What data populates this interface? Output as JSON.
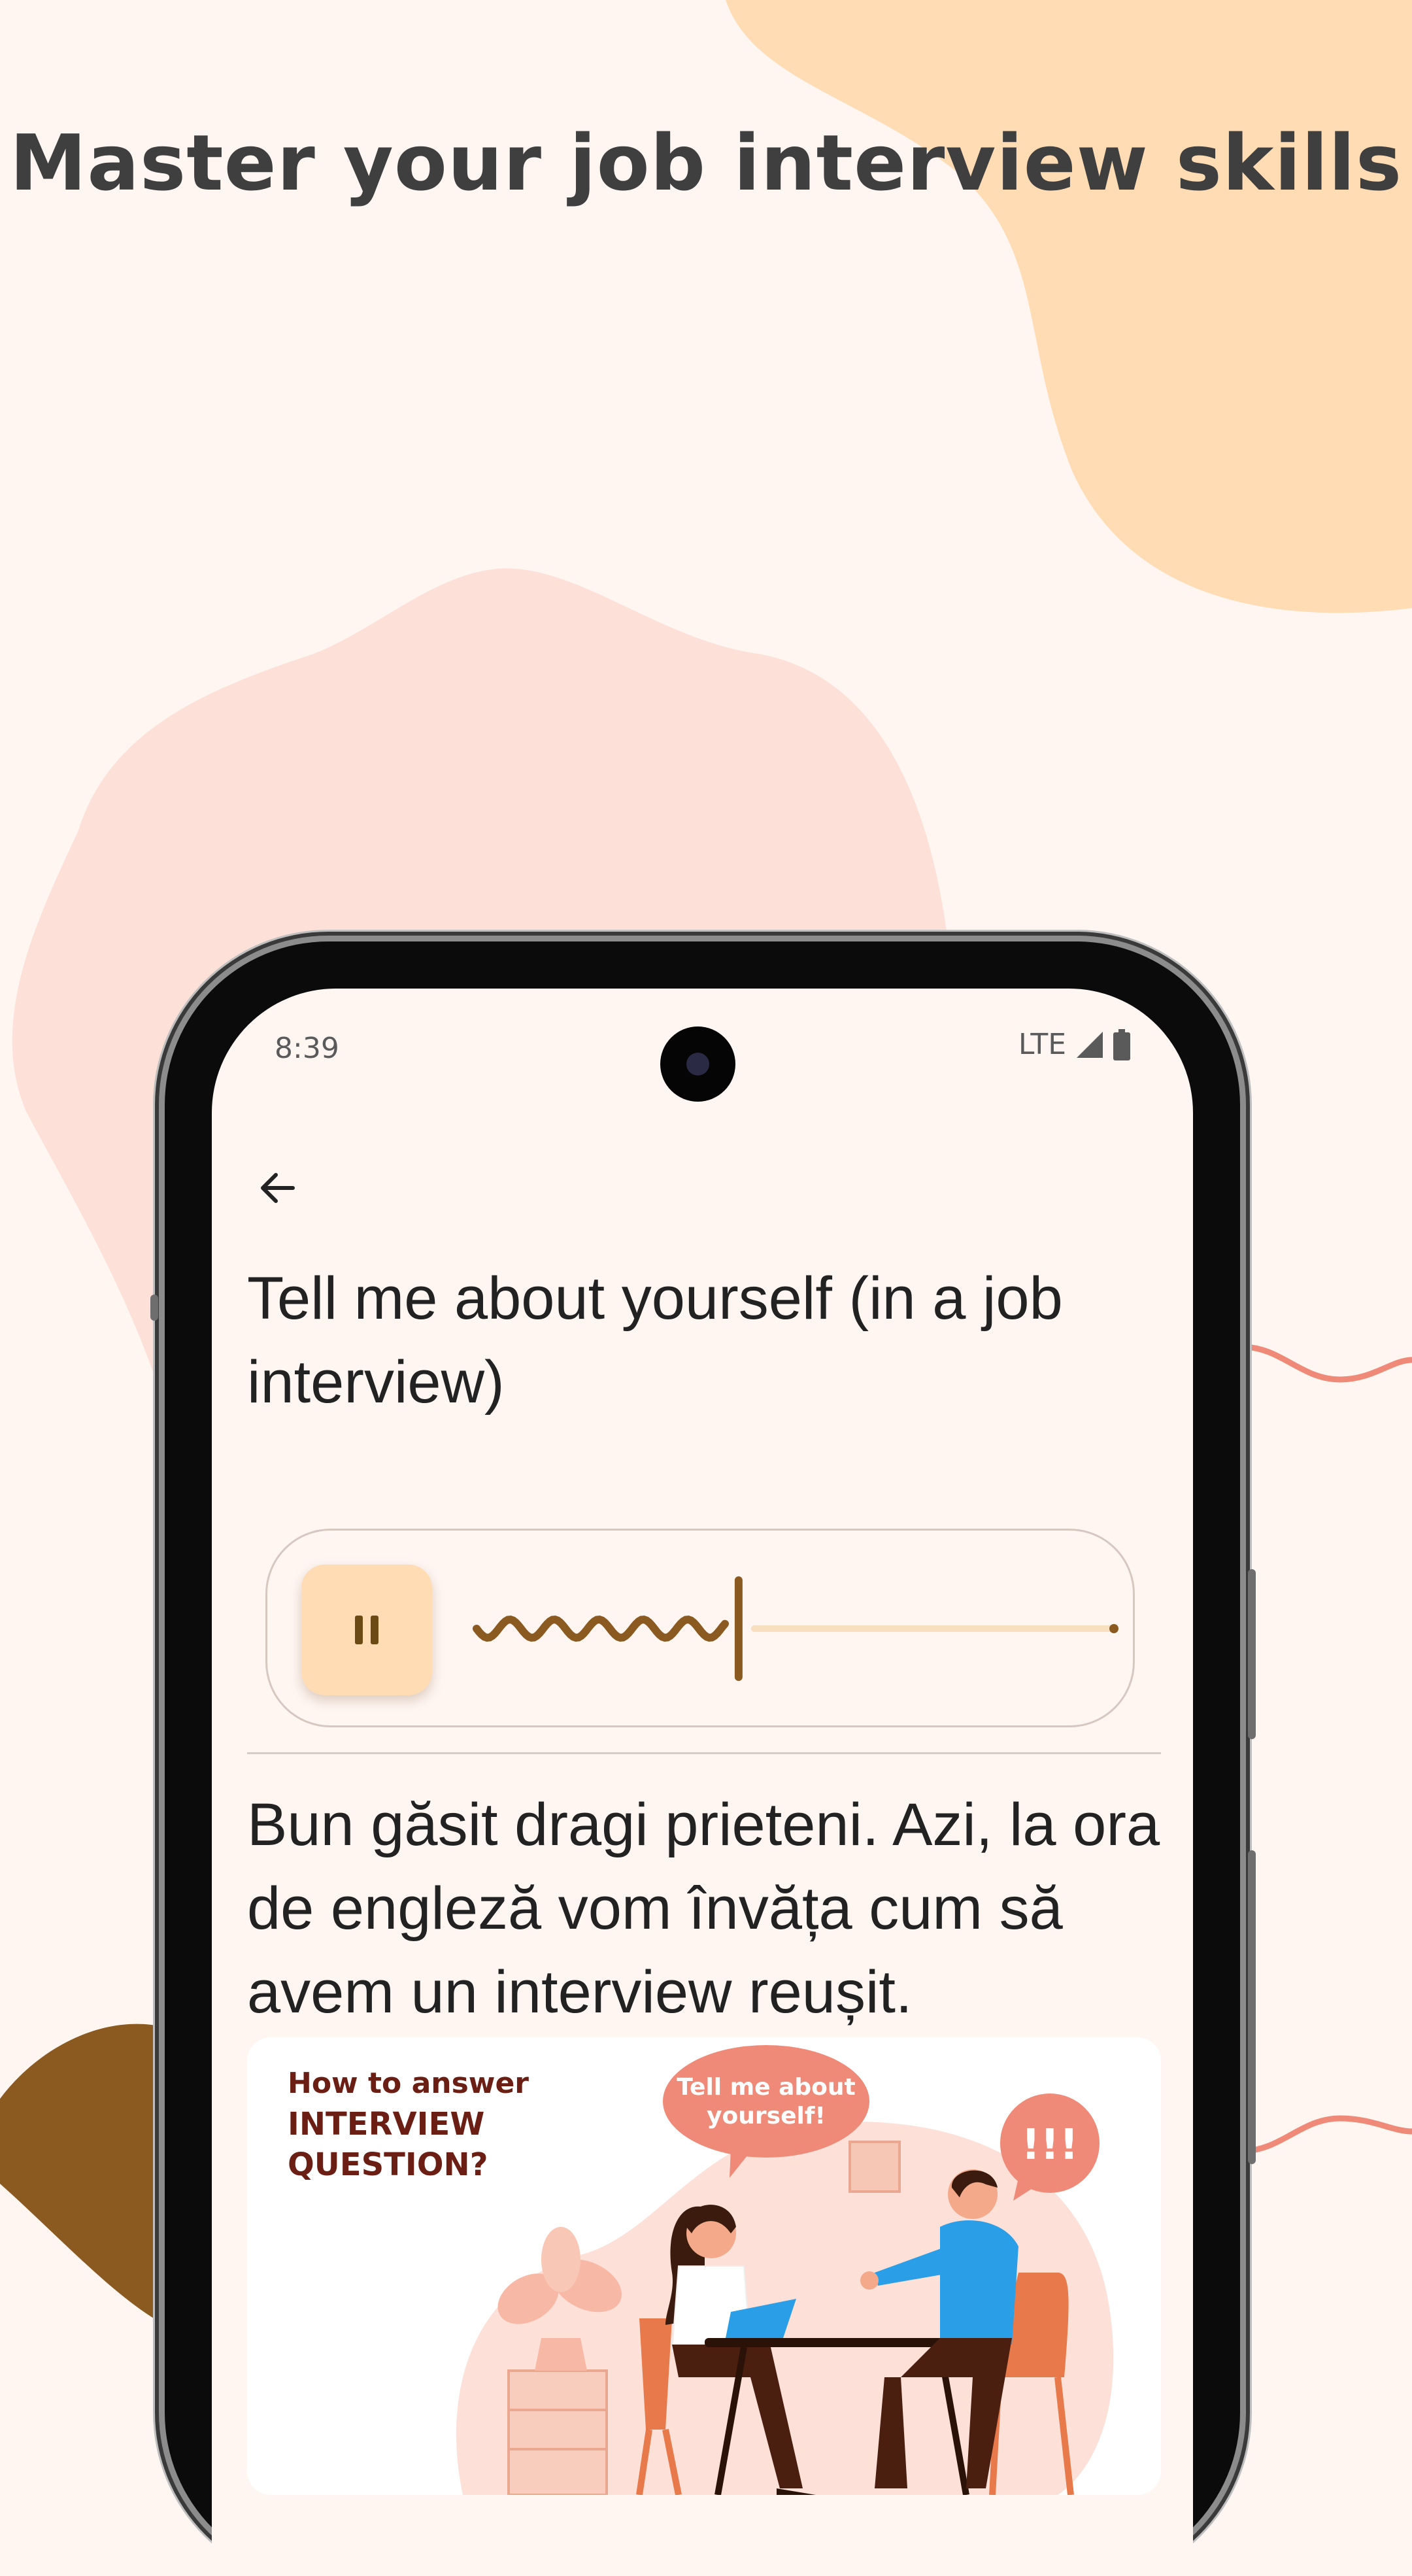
{
  "headline": "Master your job interview skills",
  "colors": {
    "background": "#fff6f2",
    "peach_blob": "#ffdcb4",
    "pink_blob": "#fde0d8",
    "brown_accent": "#8a5a20",
    "wave_line": "#ef8a78"
  },
  "status_bar": {
    "time": "8:39",
    "network": "LTE",
    "signal_icon": "signal-icon",
    "battery_icon": "battery-icon"
  },
  "screen": {
    "back_icon": "arrow-left-icon",
    "title": "Tell me about yourself (in a job interview)",
    "player": {
      "state": "playing",
      "button_icon": "pause-icon",
      "progress_percent": 30
    },
    "body_text": "Bun găsit dragi prieteni. Azi, la ora de engleză vom învăța cum să avem un interview reușit.",
    "illustration": {
      "caption_line1": "How to answer",
      "caption_line2": "INTERVIEW",
      "caption_line3": "QUESTION?",
      "speech_bubble": "Tell me about yourself!",
      "exclaim_bubble": "!!!"
    }
  }
}
